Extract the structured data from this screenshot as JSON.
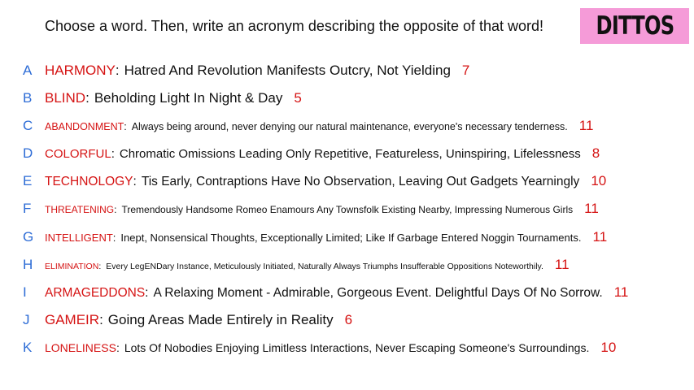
{
  "prompt": "Choose a word. Then, write an acronym describing the opposite of that word!",
  "badge": {
    "label": "DITTOS",
    "color": "#f59bd8"
  },
  "colors": {
    "letter": "#2d6cd6",
    "word": "#d51313",
    "count": "#d51313",
    "text": "#111111"
  },
  "entries": [
    {
      "letter": "A",
      "word": "HARMONY",
      "acronym": "Hatred And Revolution Manifests Outcry, Not Yielding",
      "count": "7"
    },
    {
      "letter": "B",
      "word": "BLIND",
      "acronym": "Beholding Light In Night & Day",
      "count": "5"
    },
    {
      "letter": "C",
      "word": "ABANDONMENT",
      "acronym": "Always being around, never denying our natural maintenance, everyone's necessary tenderness.",
      "count": "11"
    },
    {
      "letter": "D",
      "word": "COLORFUL",
      "acronym": "Chromatic Omissions Leading Only Repetitive, Featureless, Uninspiring, Lifelessness",
      "count": "8"
    },
    {
      "letter": "E",
      "word": "TECHNOLOGY",
      "acronym": "Tis Early, Contraptions Have No Observation, Leaving Out Gadgets Yearningly",
      "count": "10"
    },
    {
      "letter": "F",
      "word": "THREATENING",
      "acronym": "Tremendously Handsome Romeo Enamours Any Townsfolk Existing Nearby, Impressing Numerous Girls",
      "count": "11"
    },
    {
      "letter": "G",
      "word": "INTELLIGENT",
      "acronym": "Inept, Nonsensical Thoughts, Exceptionally Limited; Like If Garbage Entered Noggin Tournaments.",
      "count": "11"
    },
    {
      "letter": "H",
      "word": "ELIMINATION",
      "acronym": "Every LegENDary Instance, Meticulously Initiated, Naturally Always Triumphs Insufferable Oppositions Noteworthily.",
      "count": "11"
    },
    {
      "letter": "I",
      "word": "ARMAGEDDONS",
      "acronym": "A Relaxing Moment - Admirable, Gorgeous Event. Delightful Days Of No Sorrow.",
      "count": "11"
    },
    {
      "letter": "J",
      "word": "GAMEIR",
      "acronym": "Going Areas Made Entirely in Reality",
      "count": "6"
    },
    {
      "letter": "K",
      "word": "LONELINESS",
      "acronym": "Lots Of Nobodies Enjoying Limitless Interactions, Never Escaping Someone's Surroundings.",
      "count": "10"
    }
  ]
}
